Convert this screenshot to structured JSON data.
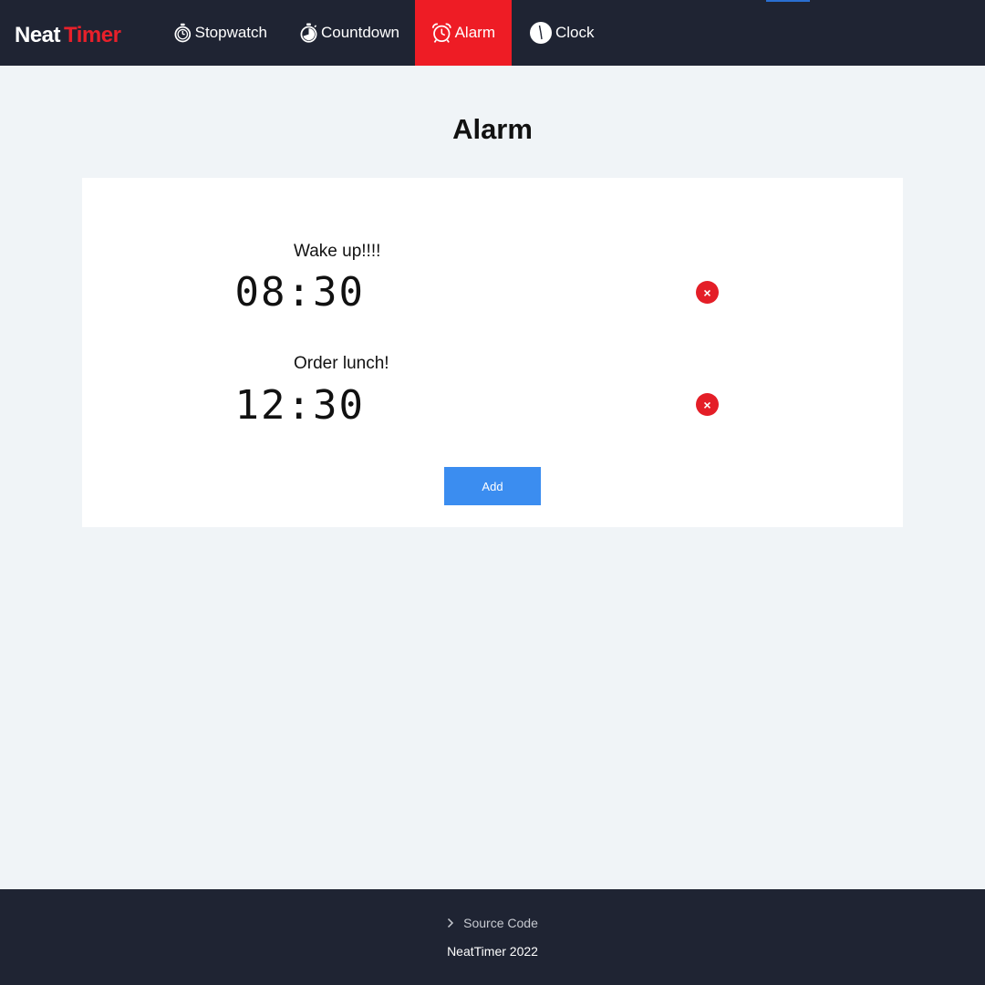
{
  "brand": {
    "part1": "Neat",
    "part2": "Timer"
  },
  "nav": {
    "items": [
      {
        "label": "Stopwatch",
        "icon": "stopwatch-icon"
      },
      {
        "label": "Countdown",
        "icon": "countdown-icon"
      },
      {
        "label": "Alarm",
        "icon": "alarm-clock-icon",
        "active": true
      },
      {
        "label": "Clock",
        "icon": "clock-icon"
      }
    ]
  },
  "page": {
    "title": "Alarm"
  },
  "alarms": [
    {
      "label": "Wake up!!!!",
      "time": "08:30"
    },
    {
      "label": "Order lunch!",
      "time": "12:30"
    }
  ],
  "remove_symbol": "×",
  "add_label": "Add",
  "footer": {
    "source_label": "Source Code",
    "copyright": "NeatTimer 2022"
  },
  "colors": {
    "navbar": "#1f2433",
    "active_tab": "#ee1c25",
    "brand_accent": "#e8202a",
    "remove_button": "#e41e27",
    "add_button": "#3b8df0",
    "page_bg": "#f0f4f7"
  }
}
